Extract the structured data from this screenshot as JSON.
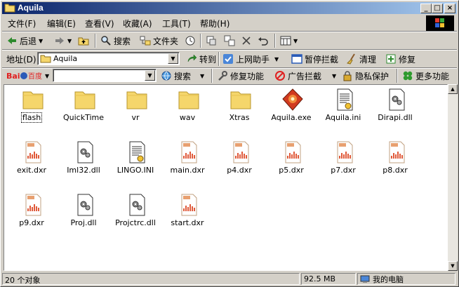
{
  "window": {
    "title": "Aquila"
  },
  "title_buttons": {
    "minimize": "_",
    "maximize": "□",
    "close": "×"
  },
  "menu": [
    "文件(F)",
    "编辑(E)",
    "查看(V)",
    "收藏(A)",
    "工具(T)",
    "帮助(H)"
  ],
  "toolbar": {
    "back": "后退",
    "search": "搜索",
    "folders": "文件夹"
  },
  "address": {
    "label": "地址(D)",
    "value": "Aquila",
    "go": "转到",
    "assistant": "上网助手",
    "block_pause": "暂停拦截",
    "clean": "清理",
    "repair": "修复"
  },
  "baidu": {
    "logo_text": "百度",
    "search": "搜索",
    "repair": "修复功能",
    "ad_block": "广告拦截",
    "privacy": "隐私保护",
    "more": "更多功能"
  },
  "files": [
    {
      "name": "flash",
      "type": "folder"
    },
    {
      "name": "QuickTime",
      "type": "folder"
    },
    {
      "name": "vr",
      "type": "folder"
    },
    {
      "name": "wav",
      "type": "folder"
    },
    {
      "name": "Xtras",
      "type": "folder"
    },
    {
      "name": "Aquila.exe",
      "type": "exe"
    },
    {
      "name": "Aquila.ini",
      "type": "ini"
    },
    {
      "name": "Dirapi.dll",
      "type": "dll"
    },
    {
      "name": "exit.dxr",
      "type": "dxr"
    },
    {
      "name": "Iml32.dll",
      "type": "dll"
    },
    {
      "name": "LINGO.INI",
      "type": "ini"
    },
    {
      "name": "main.dxr",
      "type": "dxr"
    },
    {
      "name": "p4.dxr",
      "type": "dxr"
    },
    {
      "name": "p5.dxr",
      "type": "dxr"
    },
    {
      "name": "p7.dxr",
      "type": "dxr"
    },
    {
      "name": "p8.dxr",
      "type": "dxr"
    },
    {
      "name": "p9.dxr",
      "type": "dxr"
    },
    {
      "name": "Proj.dll",
      "type": "dll"
    },
    {
      "name": "Projctrc.dll",
      "type": "dll"
    },
    {
      "name": "start.dxr",
      "type": "dxr"
    }
  ],
  "status": {
    "count": "20 个对象",
    "size": "92.5 MB",
    "location": "我的电脑"
  },
  "colors": {
    "titlebar_start": "#0a246a",
    "titlebar_end": "#a6caf0",
    "folder": "#f5d66b",
    "face": "#d4d0c8"
  }
}
